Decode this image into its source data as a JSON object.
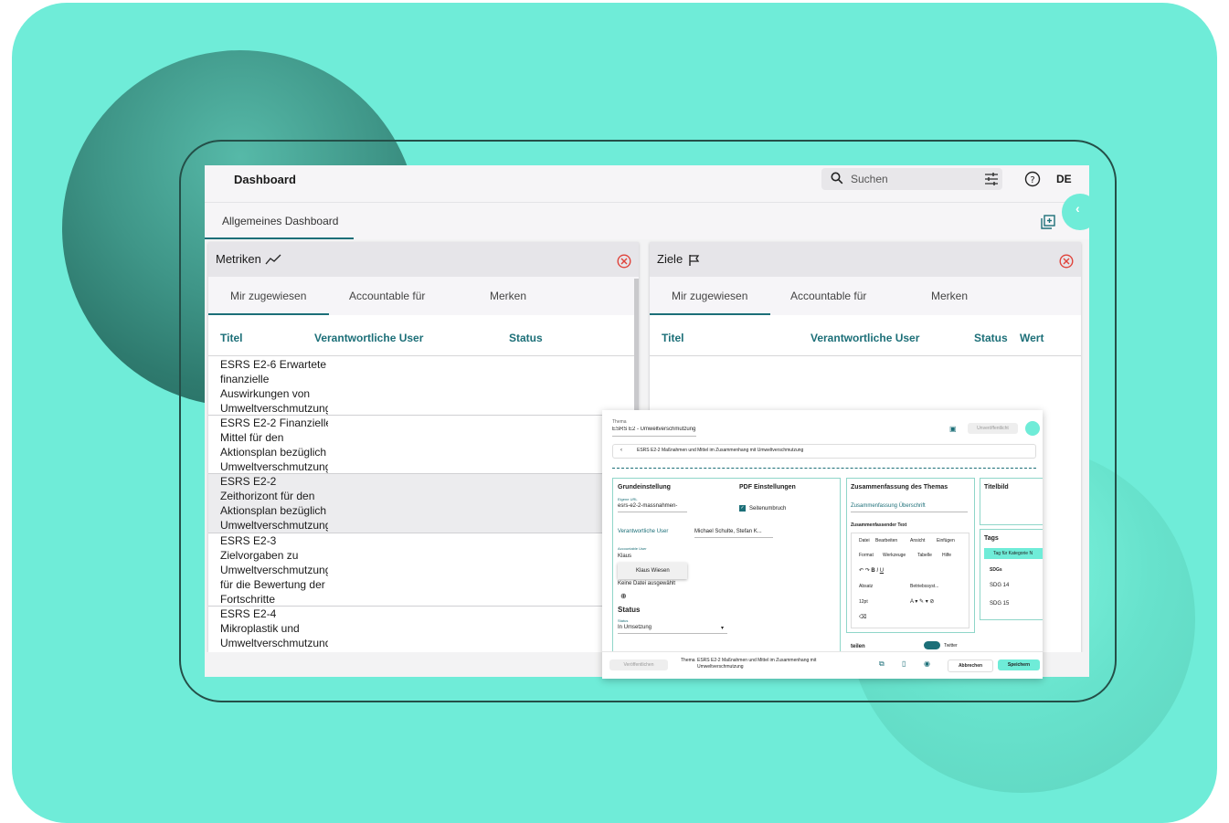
{
  "colors": {
    "background": "#6fecd8",
    "accent": "#1c6f78",
    "close_red": "#e0433b"
  },
  "topbar": {
    "title": "Dashboard",
    "search_placeholder": "Suchen",
    "language": "DE"
  },
  "subbar": {
    "tab_label": "Allgemeines Dashboard"
  },
  "metrics_panel": {
    "title": "Metriken",
    "tabs": [
      "Mir zugewiesen",
      "Accountable für",
      "Merken"
    ],
    "columns": [
      "Titel",
      "Verantwortliche User",
      "Status"
    ],
    "rows": [
      {
        "lines": [
          "ESRS E2-6 Erwartete",
          "finanzielle",
          "Auswirkungen von",
          "Umweltverschmutzung"
        ]
      },
      {
        "lines": [
          "ESRS E2-2 Finanzielle",
          "Mittel für den",
          "Aktionsplan bezüglich",
          "Umweltverschmutzung"
        ]
      },
      {
        "lines": [
          "ESRS E2-2",
          "Zeithorizont für den",
          "Aktionsplan bezüglich",
          "Umweltverschmutzung"
        ]
      },
      {
        "lines": [
          "ESRS E2-3",
          "Zielvorgaben zu",
          "Umweltverschmutzung",
          "für die Bewertung der",
          "Fortschritte"
        ]
      },
      {
        "lines": [
          "ESRS E2-4",
          "Mikroplastik und",
          "Umweltverschmutzung"
        ]
      }
    ]
  },
  "goals_panel": {
    "title": "Ziele",
    "tabs": [
      "Mir zugewiesen",
      "Accountable für",
      "Merken"
    ],
    "columns": [
      "Titel",
      "Verantwortliche User",
      "Status",
      "Wert"
    ]
  },
  "editor": {
    "theme_label": "Thema",
    "theme_value": "ESRS E2 - Umweltverschmutzung",
    "publish_top": "Unveröffentlicht",
    "breadcrumb": "ESRS E2-2 Maßnahmen und Mittel im Zusammenhang mit Umweltverschmutzung",
    "grund_title": "Grundeinstellung",
    "url_label": "Eigene URL",
    "url_value": "esrs-e2-2-massnahmen-",
    "pdf_title": "PDF Einstellungen",
    "pdf_checkbox": "Seitenumbruch",
    "resp_label": "Verantwortliche User",
    "resp_value": "Michael Schulte, Stefan K...",
    "acc_label": "Accountable User",
    "acc_value": "Klaus",
    "acc_suggestion": "Klaus Wiesen",
    "file_label": "Keine Datei ausgewählt",
    "status_title": "Status",
    "status_label": "Status",
    "status_value": "In Umsetzung",
    "summary_title": "Zusammenfassung des Themas",
    "summary_heading_ph": "Zusammenfassung Überschrift",
    "summary_text_label": "Zusammenfassender Text",
    "editor_menu": [
      "Datei",
      "Bearbeiten",
      "Ansicht",
      "Einfügen",
      "Format",
      "Werkzeuge",
      "Tabelle",
      "Hilfe"
    ],
    "format_block": "Absatz",
    "format_font": "Betriebssyst...",
    "format_size": "12pt",
    "titelbild_title": "Titelbild",
    "tags_title": "Tags",
    "tag_chip": "Tag für Kategorie N",
    "sdg_label": "SDGs",
    "sdg_items": [
      "SDG 14",
      "SDG 15"
    ],
    "share_title": "teilen",
    "twitter_label": "Twitter",
    "footer_publish": "Veröffentlichen",
    "footer_theme_label": "Thema",
    "footer_theme_value": "ESRS E2-2 Maßnahmen und Mittel im Zusammenhang mit Umweltverschmutzung",
    "cancel": "Abbrechen",
    "save": "Speichern"
  }
}
